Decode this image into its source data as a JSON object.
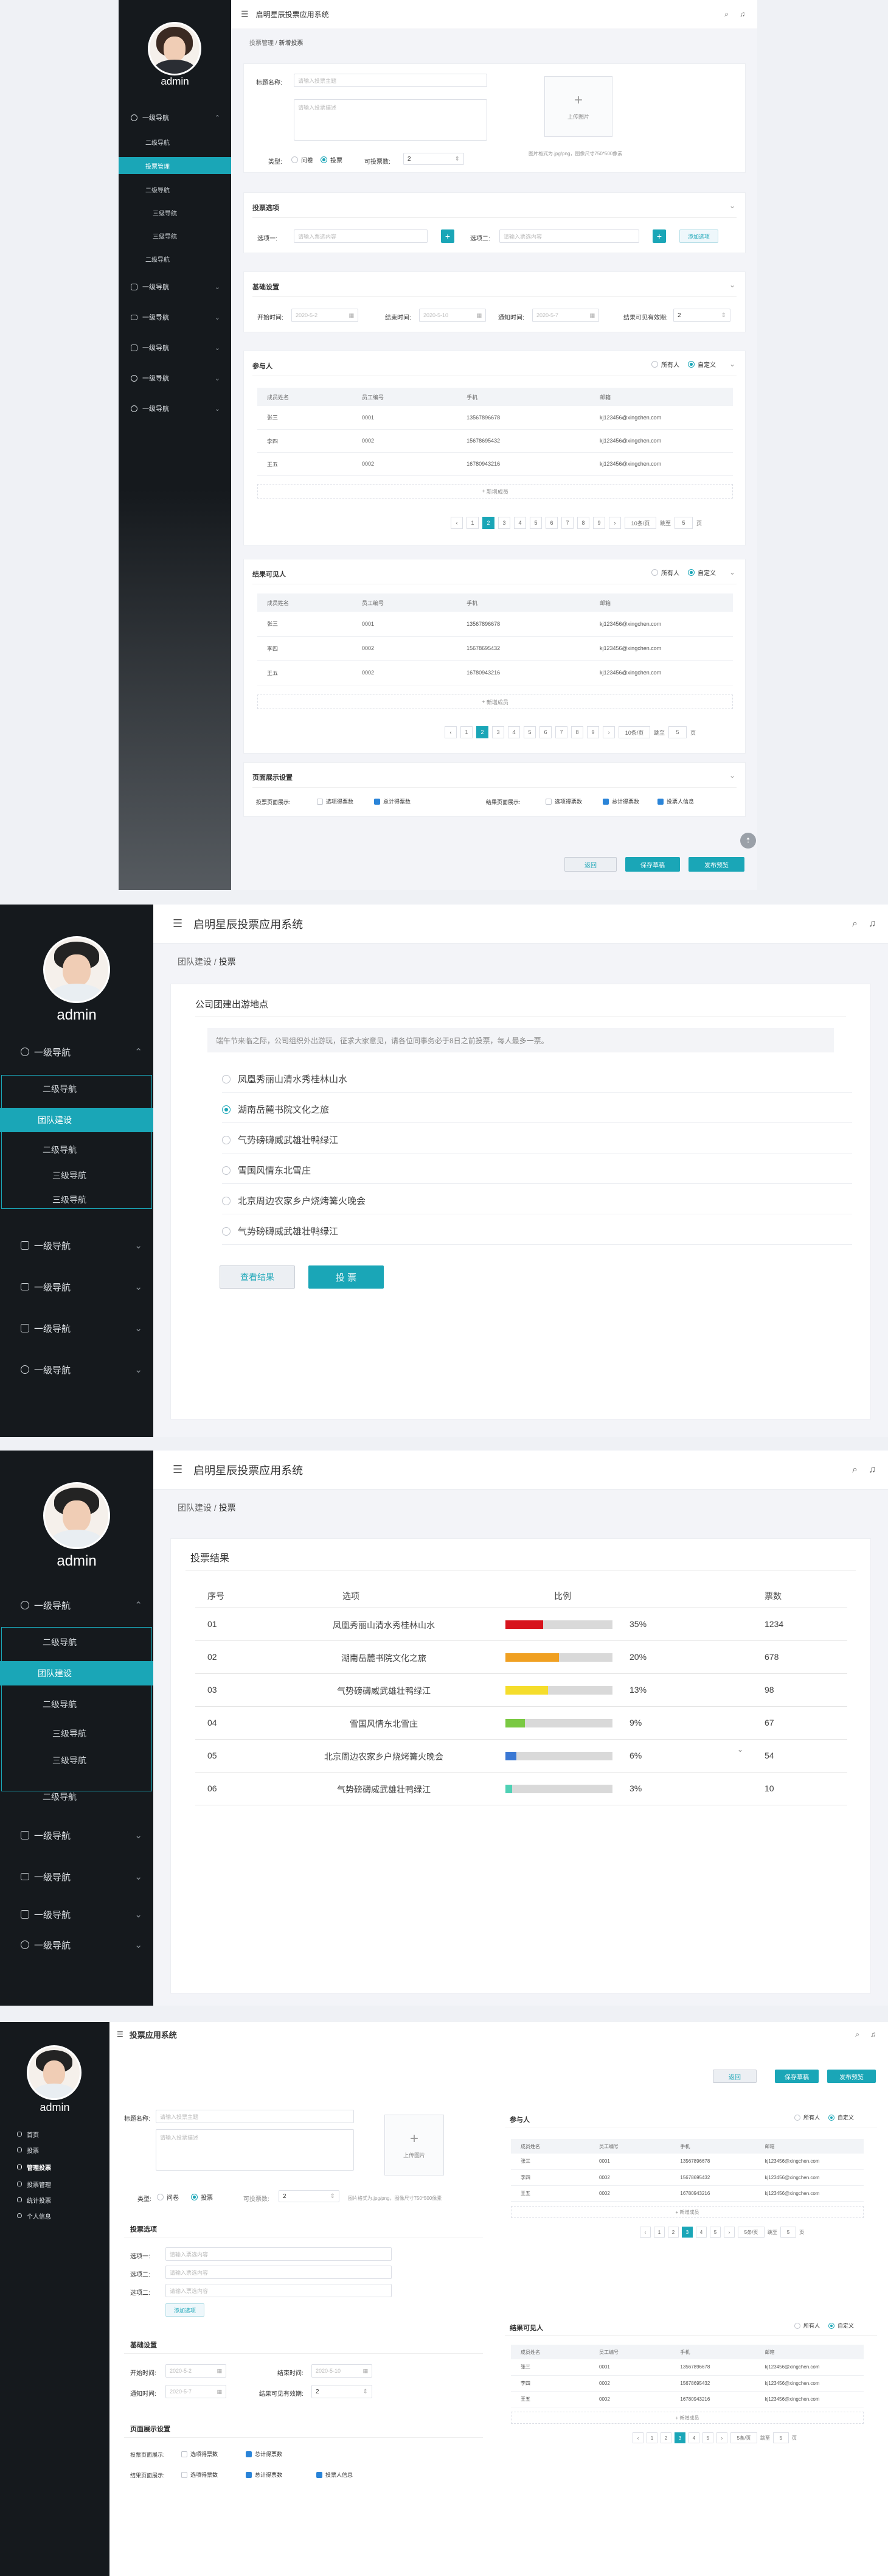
{
  "app": {
    "title": "启明星辰投票应用系统",
    "title_short": "投票应用系统",
    "user": "admin"
  },
  "colors": {
    "accent": "#1aa6b7",
    "sidebar": "#15191d",
    "red": "#d7141d",
    "orange": "#f0a022",
    "yellow": "#f5dd2c",
    "green": "#7ac943",
    "blue": "#3a78d4",
    "teal": "#4fd1b5"
  },
  "nav": {
    "level1": "一级导航",
    "level2": "二级导航",
    "level3": "三级导航",
    "team": "团队建设",
    "vote_manage": "投票管理"
  },
  "shot1": {
    "breadcrumb": {
      "parent": "投票管理",
      "current": "新增投票"
    },
    "form": {
      "title_label": "标题名称:",
      "title_placeholder": "请输入投票主题",
      "desc_placeholder": "请输入投票描述",
      "upload_label": "上传图片",
      "upload_hint": "图片格式为.jpg/png，图像尺寸750*500像素",
      "type_label": "类型:",
      "type_q": "问卷",
      "type_v": "投票",
      "votes_label": "可投票数:",
      "votes_value": "2"
    },
    "options": {
      "title": "投票选项",
      "opt1": "选项一:",
      "opt2": "选项二:",
      "placeholder": "请输入票选内容",
      "add": "添加选项"
    },
    "basic": {
      "title": "基础设置",
      "start": "开始时间:",
      "start_v": "2020-5-2",
      "end": "结束时间:",
      "end_v": "2020-5-10",
      "notify": "通知时间:",
      "notify_v": "2020-5-7",
      "visible": "结果可见有效期:",
      "visible_v": "2"
    },
    "participants": {
      "title": "参与人",
      "all": "所有人",
      "custom": "自定义",
      "add": "新增成员"
    },
    "visible_people": {
      "title": "结果可见人",
      "all": "所有人",
      "custom": "自定义",
      "add": "新增成员"
    },
    "columns": [
      "成员姓名",
      "员工编号",
      "手机",
      "邮箱"
    ],
    "rows": [
      [
        "张三",
        "0001",
        "13567896678",
        "kj123456@xingchen.com"
      ],
      [
        "李四",
        "0002",
        "15678695432",
        "kj123456@xingchen.com"
      ],
      [
        "王五",
        "0002",
        "16780943216",
        "kj123456@xingchen.com"
      ]
    ],
    "pager": {
      "pages": [
        "1",
        "2",
        "3",
        "4",
        "5",
        "6",
        "7",
        "8",
        "9"
      ],
      "per": "10条/页",
      "jump": "跳至",
      "jump_v": "5",
      "unit": "页"
    },
    "display": {
      "title": "页面展示设置",
      "label1": "投票页面展示:",
      "label2": "结果页面展示:",
      "c1": "选项得票数",
      "c2": "总计得票数",
      "c3": "选项得票数",
      "c4": "总计得票数",
      "c5": "投票人信息"
    },
    "actions": {
      "back": "返回",
      "save": "保存草稿",
      "publish": "发布预览"
    }
  },
  "shot2": {
    "breadcrumb": {
      "parent": "团队建设",
      "current": "投票"
    },
    "title": "公司团建出游地点",
    "desc": "端午节来临之际，公司组织外出游玩，征求大家意见，请各位同事务必于8日之前投票，每人最多一票。",
    "options": [
      "凤凰秀丽山清水秀桂林山水",
      "湖南岳麓书院文化之旅",
      "气势磅礴威武雄壮鸭绿江",
      "雪国风情东北雪庄",
      "北京周边农家乡户烧烤篝火晚会",
      "气势磅礴威武雄壮鸭绿江"
    ],
    "selected": 1,
    "view": "查看结果",
    "vote": "投 票"
  },
  "shot3": {
    "breadcrumb": {
      "parent": "团队建设",
      "current": "投票"
    },
    "title": "投票结果",
    "columns": [
      "序号",
      "选项",
      "比例",
      "票数"
    ],
    "rows": [
      {
        "no": "01",
        "name": "凤凰秀丽山清水秀桂林山水",
        "pct": "35%",
        "val": 35,
        "votes": "1234",
        "color": "#d7141d"
      },
      {
        "no": "02",
        "name": "湖南岳麓书院文化之旅",
        "pct": "20%",
        "val": 50,
        "votes": "678",
        "color": "#f0a022"
      },
      {
        "no": "03",
        "name": "气势磅礴威武雄壮鸭绿江",
        "pct": "13%",
        "val": 40,
        "votes": "98",
        "color": "#f5dd2c"
      },
      {
        "no": "04",
        "name": "雪国风情东北雪庄",
        "pct": "9%",
        "val": 18,
        "votes": "67",
        "color": "#7ac943"
      },
      {
        "no": "05",
        "name": "北京周边农家乡户烧烤篝火晚会",
        "pct": "6%",
        "val": 10,
        "votes": "54",
        "color": "#3a78d4"
      },
      {
        "no": "06",
        "name": "气势磅礴威武雄壮鸭绿江",
        "pct": "3%",
        "val": 6,
        "votes": "10",
        "color": "#4fd1b5"
      }
    ]
  },
  "shot4": {
    "nav": [
      "首页",
      "投票",
      "管理投票",
      "投票管理",
      "统计投票",
      "个人信息"
    ],
    "per": "5条/页",
    "pages": [
      "1",
      "2",
      "3",
      "4",
      "5"
    ]
  }
}
